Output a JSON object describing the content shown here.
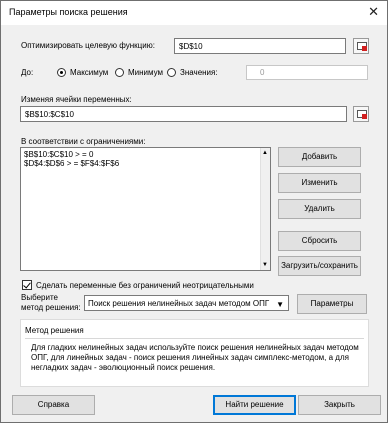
{
  "window": {
    "title": "Параметры поиска решения",
    "close_glyph": "✕"
  },
  "objective": {
    "label": "Оптимизировать целевую функцию:",
    "value": "$D$10"
  },
  "to": {
    "label": "До:",
    "options": [
      "Максимум",
      "Минимум",
      "Значения:"
    ],
    "selected": "Максимум",
    "value_field": "0"
  },
  "variables": {
    "label": "Изменяя ячейки переменных:",
    "value": "$B$10:$C$10"
  },
  "constraints": {
    "label": "В соответствии с ограничениями:",
    "items": [
      "$B$10:$C$10 > = 0",
      "$D$4:$D$6 > = $F$4:$F$6"
    ],
    "buttons": [
      "Добавить",
      "Изменить",
      "Удалить",
      "Сбросить",
      "Загрузить/сохранить"
    ]
  },
  "nonneg": {
    "label": "Сделать переменные без ограничений неотрицательными",
    "checked": true
  },
  "method": {
    "label_line1": "Выберите",
    "label_line2": "метод решения:",
    "selected": "Поиск решения нелинейных задач методом ОПГ",
    "params_button": "Параметры"
  },
  "description": {
    "title": "Метод решения",
    "line1": "Для гладких нелинейных задач используйте поиск решения нелинейных задач методом",
    "line2": "ОПГ, для линейных задач - поиск решения линейных задач симплекс-методом, а для",
    "line3": "негладких задач - эволюционный поиск решения."
  },
  "footer": {
    "help": "Справка",
    "solve": "Найти решение",
    "close": "Закрыть"
  }
}
